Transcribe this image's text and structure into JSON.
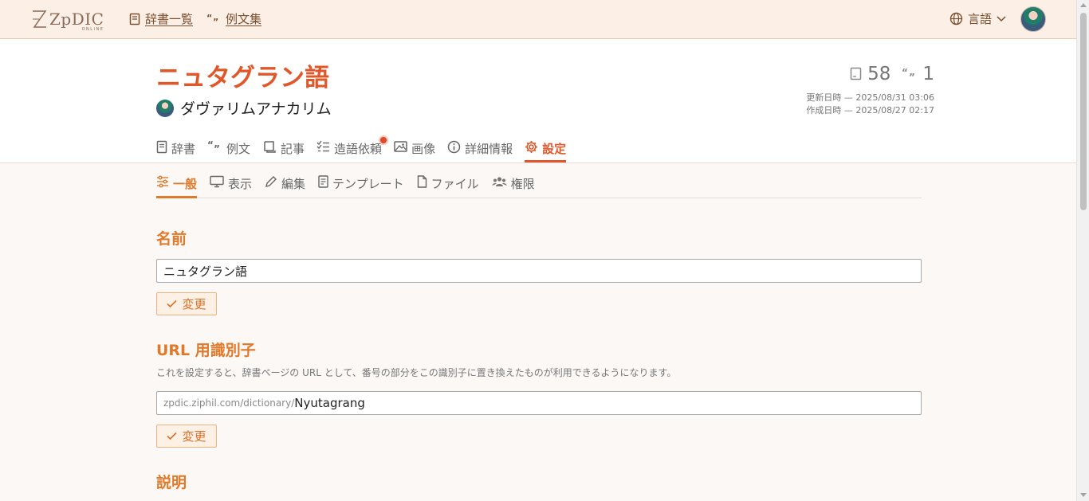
{
  "header": {
    "logo_text": "ZpDIC",
    "logo_sub": "ONLINE",
    "nav": [
      {
        "label": "辞書一覧",
        "icon": "book-icon"
      },
      {
        "label": "例文集",
        "icon": "quote-icon"
      }
    ],
    "language_label": "言語"
  },
  "dictionary": {
    "name": "ニュタグラン語",
    "owner": "ダヴァリムアナカリム",
    "word_count": "58",
    "example_count": "1",
    "updated": "更新日時 — 2025/08/31 03:06",
    "created": "作成日時 — 2025/08/27 02:17"
  },
  "main_tabs": [
    {
      "label": "辞書",
      "icon": "book-icon"
    },
    {
      "label": "例文",
      "icon": "quote-icon"
    },
    {
      "label": "記事",
      "icon": "scroll-icon"
    },
    {
      "label": "造語依頼",
      "icon": "checklist-icon",
      "notification": true
    },
    {
      "label": "画像",
      "icon": "image-icon"
    },
    {
      "label": "詳細情報",
      "icon": "info-icon"
    },
    {
      "label": "設定",
      "icon": "gear-icon",
      "active": true
    }
  ],
  "sub_tabs": [
    {
      "label": "一般",
      "icon": "sliders-icon",
      "active": true
    },
    {
      "label": "表示",
      "icon": "monitor-icon"
    },
    {
      "label": "編集",
      "icon": "pencil-icon"
    },
    {
      "label": "テンプレート",
      "icon": "template-icon"
    },
    {
      "label": "ファイル",
      "icon": "file-icon"
    },
    {
      "label": "権限",
      "icon": "users-icon"
    }
  ],
  "sections": {
    "name": {
      "title": "名前",
      "value": "ニュタグラン語",
      "button": "変更"
    },
    "url": {
      "title": "URL 用識別子",
      "description": "これを設定すると、辞書ページの URL として、番号の部分をこの識別子に置き換えたものが利用できるようになります。",
      "prefix": "zpdic.ziphil.com/dictionary/",
      "value": "Nyutagrang",
      "button": "変更"
    },
    "description": {
      "title": "説明"
    }
  },
  "colors": {
    "accent_red": "#e0582a",
    "accent_orange": "#e07a2a",
    "header_bg": "#fcefe6"
  }
}
